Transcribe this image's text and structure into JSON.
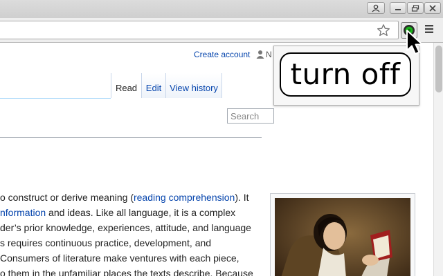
{
  "browser": {
    "colors": {
      "chrome": "#dcdcdc",
      "toolbar": "#eeeeee",
      "ext_green": "#19b319"
    },
    "icons": [
      "profile-icon",
      "minimize-icon",
      "restore-icon",
      "close-icon",
      "star-icon",
      "extension-toggle-icon",
      "menu-icon"
    ]
  },
  "page": {
    "personal_tools": {
      "create_account": "Create account",
      "user_initial": "N"
    },
    "tabs": {
      "read": "Read",
      "edit": "Edit",
      "view_history": "View history"
    },
    "search": {
      "placeholder": "Search"
    },
    "article_lines": [
      {
        "pre": "o construct or derive meaning (",
        "link": "reading comprehension",
        "post": "). It"
      },
      {
        "pre": "",
        "link": "nformation",
        "post": " and ideas. Like all language, it is a complex"
      },
      {
        "pre": "der’s prior knowledge, experiences, attitude, and language",
        "link": "",
        "post": ""
      },
      {
        "pre": "s requires continuous practice, development, and",
        "link": "",
        "post": ""
      },
      {
        "pre": "Consumers of literature make ventures with each piece,",
        "link": "",
        "post": ""
      },
      {
        "pre": "o them in the unfamiliar places the texts describe. Because",
        "link": "",
        "post": ""
      }
    ],
    "link_color": "#0645ad"
  },
  "tooltip": {
    "text": "turn off"
  }
}
